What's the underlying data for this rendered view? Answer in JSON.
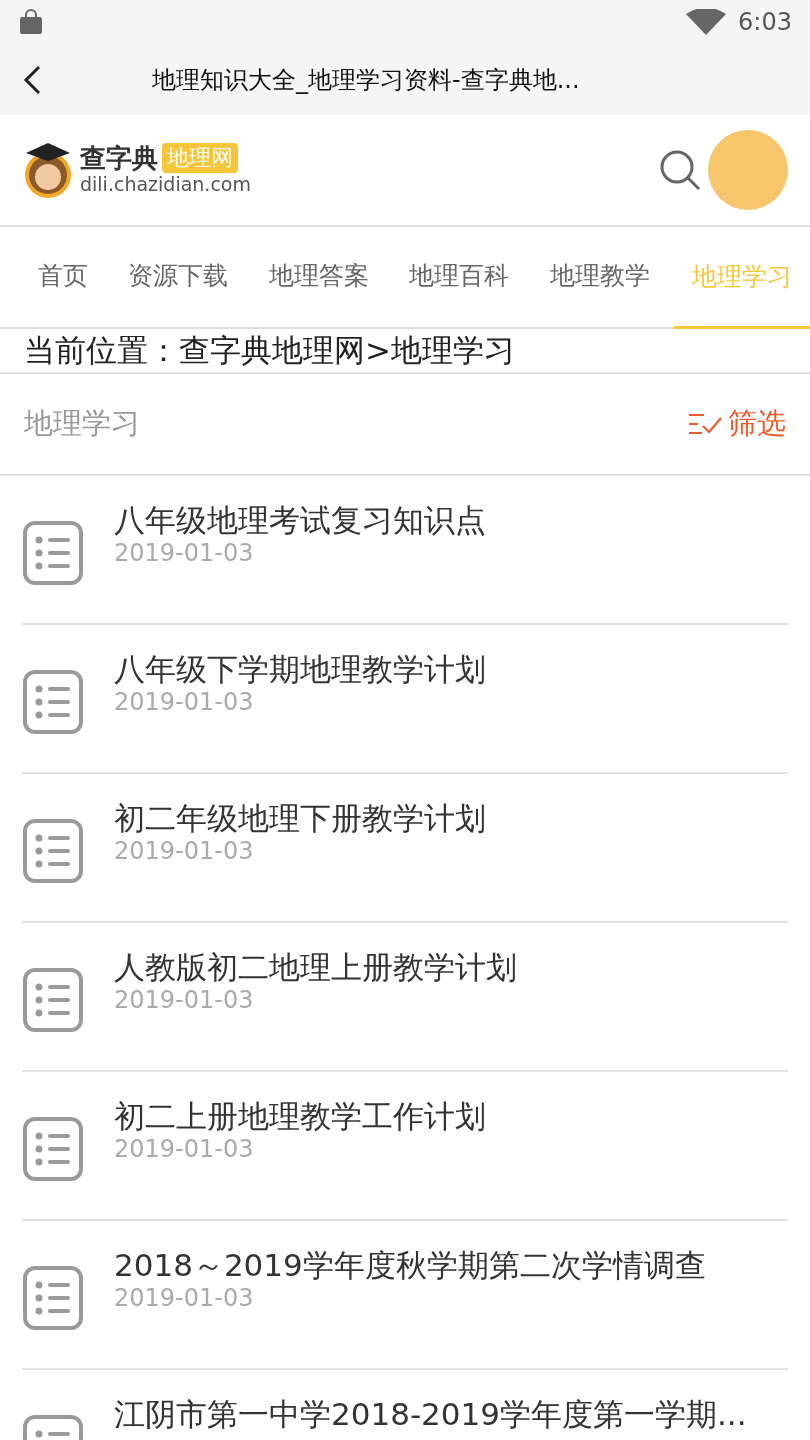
{
  "status_bar": {
    "time": "6:03"
  },
  "title_bar": {
    "title": "地理知识大全_地理学习资料-查字典地..."
  },
  "site_header": {
    "brand": "查字典",
    "badge": "地理网",
    "domain": "dili.chazidian.com"
  },
  "tabs": [
    {
      "label": "首页",
      "selected": false
    },
    {
      "label": "资源下载",
      "selected": false
    },
    {
      "label": "地理答案",
      "selected": false
    },
    {
      "label": "地理百科",
      "selected": false
    },
    {
      "label": "地理教学",
      "selected": false
    },
    {
      "label": "地理学习",
      "selected": true
    }
  ],
  "breadcrumb": "当前位置：查字典地理网>地理学习",
  "section": {
    "title": "地理学习",
    "filter": "筛选"
  },
  "articles": [
    {
      "title": "八年级地理考试复习知识点",
      "date": "2019-01-03"
    },
    {
      "title": "八年级下学期地理教学计划",
      "date": "2019-01-03"
    },
    {
      "title": "初二年级地理下册教学计划",
      "date": "2019-01-03"
    },
    {
      "title": "人教版初二地理上册教学计划",
      "date": "2019-01-03"
    },
    {
      "title": "初二上册地理教学工作计划",
      "date": "2019-01-03"
    },
    {
      "title": "2018～2019学年度秋学期第二次学情调查",
      "date": "2019-01-03"
    },
    {
      "title": "江阴市第一中学2018-2019学年度第一学期..."
    }
  ]
}
